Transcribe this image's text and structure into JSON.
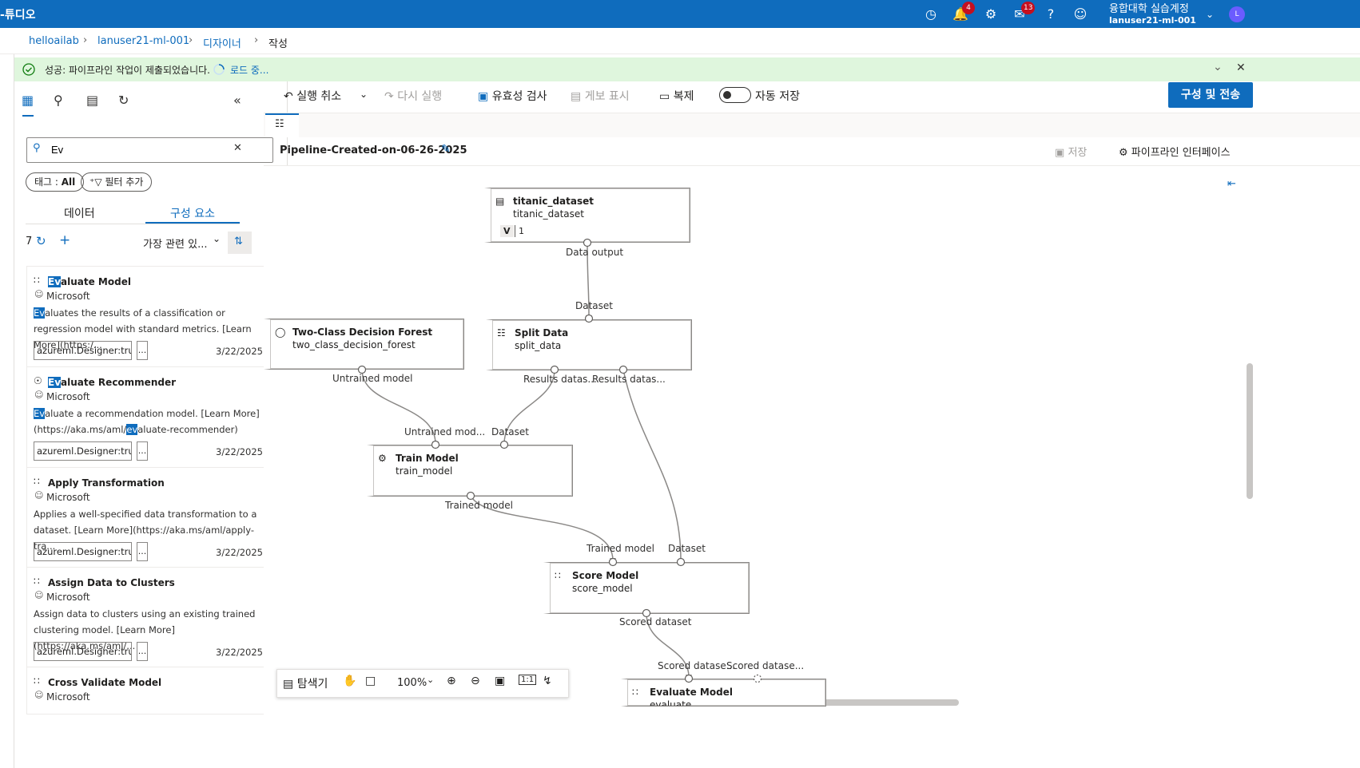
{
  "topbar": {
    "app_title": "-튜디오",
    "notif_count": "4",
    "feedback_count": "13",
    "user_line1": "융합대학 실습계정",
    "user_line2": "lanuser21-ml-001",
    "avatar_letter": "L",
    "accent": "#0f6cbd"
  },
  "breadcrumb": {
    "items": [
      "helloailab",
      "lanuser21-ml-001",
      "디자이너",
      "작성"
    ]
  },
  "banner": {
    "message": "성공: 파이프라인 작업이 제출되었습니다.",
    "loading": "로드 중..."
  },
  "left_panel": {
    "search_value": "Ev",
    "tag_pill_prefix": "태그 : ",
    "tag_pill_value": "All",
    "add_filter": "필터 추가",
    "tabs": [
      "데이터",
      "구성 요소"
    ],
    "active_tab": "구성 요소",
    "count": "7",
    "sort_label": "가장 관련 있...",
    "cards": [
      {
        "title_hl": "Ev",
        "title_rest": "aluate Model",
        "publisher": "Microsoft",
        "desc_hl": "Ev",
        "desc_rest": "aluates the results of a classification or regression model with standard metrics. [Learn More](https:/...",
        "tag": "azureml.Designer:true",
        "more": "...",
        "date": "3/22/2025",
        "icon": "chart-icon"
      },
      {
        "title_hl": "Ev",
        "title_rest": "aluate Recommender",
        "publisher": "Microsoft",
        "desc_hl": "Ev",
        "desc_rest": "aluate a recommendation model. [Learn More](https://aka.ms/aml/",
        "desc_hl2": "ev",
        "desc_rest2": "aluate-recommender)",
        "tag": "azureml.Designer:true",
        "more": "...",
        "date": "3/22/2025",
        "icon": "lightbulb-icon"
      },
      {
        "title": "Apply Transformation",
        "publisher": "Microsoft",
        "desc": "Applies a well-specified data transformation to a dataset. [Learn More](https://aka.ms/aml/apply-tra...",
        "tag": "azureml.Designer:true",
        "more": "...",
        "date": "3/22/2025",
        "icon": "chart-icon"
      },
      {
        "title": "Assign Data to Clusters",
        "publisher": "Microsoft",
        "desc": "Assign data to clusters using an existing trained clustering model. [Learn More](https://aka.ms/aml/...",
        "tag": "azureml.Designer:true",
        "more": "...",
        "date": "3/22/2025",
        "icon": "chart-icon"
      },
      {
        "title": "Cross Validate Model",
        "publisher": "Microsoft",
        "icon": "chart-icon"
      }
    ]
  },
  "toolbar": {
    "undo": "실행 취소",
    "redo": "다시 실행",
    "validate": "유효성 검사",
    "publish": "게보 표시",
    "clone": "복제",
    "autosave": "자동 저장",
    "submit": "구성 및 전송"
  },
  "pipeline": {
    "name": "Pipeline-Created-on-06-26-2025",
    "save": "저장",
    "interface": "파이프라인 인터페이스"
  },
  "nodes": {
    "titanic": {
      "title": "titanic_dataset",
      "sub": "titanic_dataset",
      "version_label": "V",
      "version": "1",
      "out": "Data output"
    },
    "split": {
      "title": "Split Data",
      "sub": "split_data",
      "in": "Dataset",
      "out1": "Results datas...",
      "out2": "Results datas..."
    },
    "forest": {
      "title": "Two-Class Decision Forest",
      "sub": "two_class_decision_forest",
      "out": "Untrained model"
    },
    "train": {
      "title": "Train Model",
      "sub": "train_model",
      "in1": "Untrained mod...",
      "in2": "Dataset",
      "out": "Trained model"
    },
    "score": {
      "title": "Score Model",
      "sub": "score_model",
      "in1": "Trained model",
      "in2": "Dataset",
      "out": "Scored dataset"
    },
    "evaluate": {
      "title": "Evaluate Model",
      "sub": "evaluate",
      "in1": "Scored datase...",
      "in2": "Scored datase..."
    }
  },
  "zoom": {
    "explorer": "탐색기",
    "level": "100%"
  }
}
